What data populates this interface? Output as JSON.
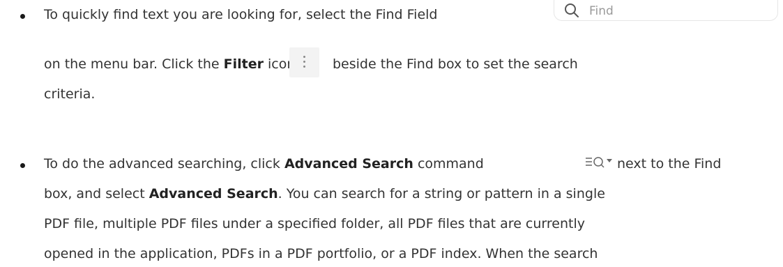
{
  "find_field": {
    "placeholder": "Find",
    "icon": "search-icon"
  },
  "bullet1": {
    "line1": "To quickly find text you are looking for, select the Find Field",
    "line2_a": "on the menu bar. Click the",
    "line2_b": "Filter",
    "line2_c": "icon",
    "line2_d": "beside the Find box to set the search",
    "line3": "criteria."
  },
  "bullet2": {
    "line1_a": "To do the advanced searching, click",
    "line1_b": "Advanced Search",
    "line1_c": "command",
    "line1_d": "next to the Find",
    "line2_a": "box, and select",
    "line2_b": "Advanced Search",
    "line2_c": ". You can search for a string or pattern in a single",
    "line3": "PDF file, multiple PDF files under a specified folder, all PDF files that are currently",
    "line4": "opened in the application, PDFs in a PDF portfolio, or a PDF index. When the search"
  },
  "icons": {
    "filter": "kebab-menu-icon",
    "advanced_search": "advanced-search-icon"
  }
}
